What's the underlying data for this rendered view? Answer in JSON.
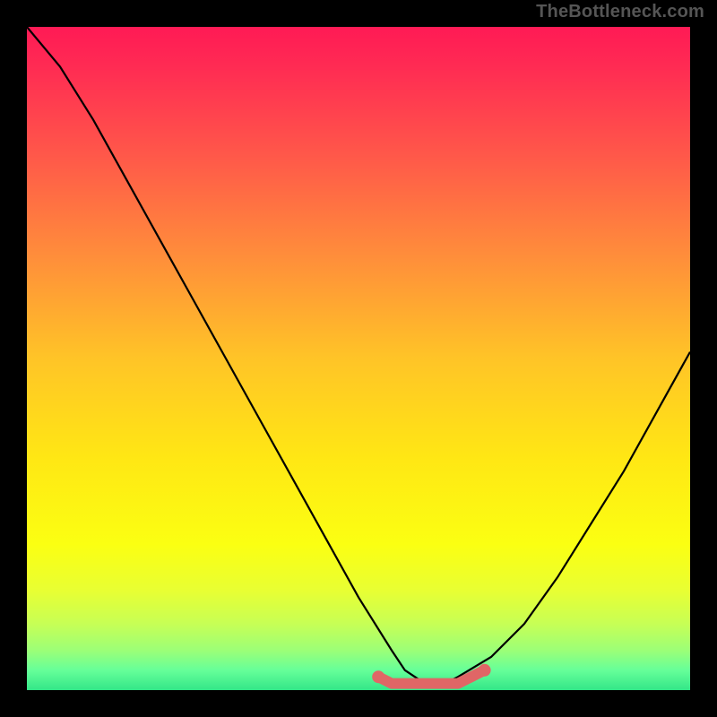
{
  "watermark": "TheBottleneck.com",
  "chart_data": {
    "type": "line",
    "title": "",
    "xlabel": "",
    "ylabel": "",
    "xlim": [
      0,
      100
    ],
    "ylim": [
      0,
      100
    ],
    "grid": false,
    "legend": false,
    "series": [
      {
        "name": "curve",
        "x": [
          0,
          5,
          10,
          15,
          20,
          25,
          30,
          35,
          40,
          45,
          50,
          55,
          57,
          60,
          63,
          65,
          70,
          75,
          80,
          85,
          90,
          95,
          100
        ],
        "values": [
          100,
          94,
          86,
          77,
          68,
          59,
          50,
          41,
          32,
          23,
          14,
          6,
          3,
          1,
          1,
          2,
          5,
          10,
          17,
          25,
          33,
          42,
          51
        ]
      },
      {
        "name": "flat-marker",
        "x": [
          53,
          55,
          57,
          59,
          61,
          63,
          65,
          67,
          69
        ],
        "values": [
          2,
          1,
          1,
          1,
          1,
          1,
          1,
          2,
          3
        ]
      }
    ],
    "gradient_stops": [
      {
        "offset": 0.0,
        "color": "#ff1a55"
      },
      {
        "offset": 0.06,
        "color": "#ff2b53"
      },
      {
        "offset": 0.2,
        "color": "#ff5a49"
      },
      {
        "offset": 0.35,
        "color": "#ff8f3a"
      },
      {
        "offset": 0.5,
        "color": "#ffc427"
      },
      {
        "offset": 0.65,
        "color": "#ffe714"
      },
      {
        "offset": 0.78,
        "color": "#fbff12"
      },
      {
        "offset": 0.85,
        "color": "#e8ff33"
      },
      {
        "offset": 0.9,
        "color": "#c7ff55"
      },
      {
        "offset": 0.94,
        "color": "#9cff77"
      },
      {
        "offset": 0.97,
        "color": "#66ff99"
      },
      {
        "offset": 1.0,
        "color": "#33e688"
      }
    ],
    "marker_color": "#e06666",
    "curve_color": "#000000"
  }
}
